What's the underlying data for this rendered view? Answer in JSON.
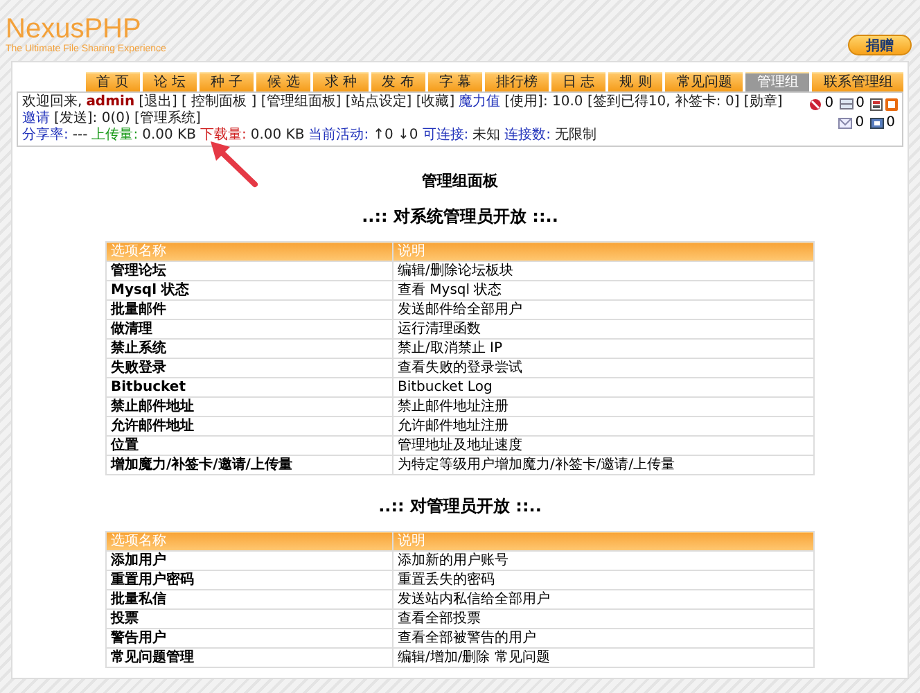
{
  "logo": {
    "title": "NexusPHP",
    "tagline": "The Ultimate File Sharing Experience"
  },
  "donate_button": "捐赠",
  "nav": [
    {
      "label": "首 页",
      "selected": false
    },
    {
      "label": "论 坛",
      "selected": false
    },
    {
      "label": "种 子",
      "selected": false
    },
    {
      "label": "候 选",
      "selected": false
    },
    {
      "label": "求 种",
      "selected": false
    },
    {
      "label": "发 布",
      "selected": false
    },
    {
      "label": "字 幕",
      "selected": false
    },
    {
      "label": "排行榜",
      "selected": false
    },
    {
      "label": "日 志",
      "selected": false
    },
    {
      "label": "规 则",
      "selected": false
    },
    {
      "label": "常见问题",
      "selected": false
    },
    {
      "label": "管理组",
      "selected": true
    },
    {
      "label": "联系管理组",
      "selected": false
    }
  ],
  "user_bar": {
    "lines": [
      [
        {
          "kind": "text",
          "text": "欢迎回来,"
        },
        {
          "kind": "user",
          "text": "admin"
        },
        {
          "kind": "text",
          "text": "[退出] [ 控制面板 ] [管理组面板] [站点设定] [收藏]"
        },
        {
          "kind": "link",
          "text": "魔力值"
        },
        {
          "kind": "text",
          "text": "[使用]: 10.0 [签到已得10, 补签卡: 0] [勋章]"
        },
        {
          "kind": "link",
          "text": "邀请"
        },
        {
          "kind": "text",
          "text": "[发送]: 0(0) [管理系统]"
        }
      ],
      [
        {
          "kind": "link",
          "text": "分享率:"
        },
        {
          "kind": "text",
          "text": "---"
        },
        {
          "kind": "up",
          "text": "上传量:"
        },
        {
          "kind": "text",
          "text": "0.00 KB"
        },
        {
          "kind": "down",
          "text": "下载量:"
        },
        {
          "kind": "text",
          "text": "0.00 KB"
        },
        {
          "kind": "link",
          "text": "当前活动:"
        },
        {
          "kind": "text",
          "text": "↑0 ↓0"
        },
        {
          "kind": "link",
          "text": "可连接:"
        },
        {
          "kind": "text",
          "text": "未知"
        },
        {
          "kind": "link",
          "text": "连接数:"
        },
        {
          "kind": "text",
          "text": "无限制"
        }
      ]
    ],
    "indicators": [
      [
        {
          "kind": "alert",
          "count": "0"
        },
        {
          "kind": "inbox",
          "count": "0"
        },
        {
          "kind": "bookmark"
        },
        {
          "kind": "rss"
        }
      ],
      [
        {
          "kind": "mail",
          "count": "0"
        },
        {
          "kind": "sent",
          "count": "0"
        }
      ]
    ]
  },
  "panel_title": "管理组面板",
  "sections": [
    {
      "heading": "..:: 对系统管理员开放 ::..",
      "columns": [
        "选项名称",
        "说明"
      ],
      "rows": [
        [
          "管理论坛",
          "编辑/删除论坛板块"
        ],
        [
          "Mysql 状态",
          "查看 Mysql 状态"
        ],
        [
          "批量邮件",
          "发送邮件给全部用户"
        ],
        [
          "做清理",
          "运行清理函数"
        ],
        [
          "禁止系统",
          "禁止/取消禁止 IP"
        ],
        [
          "失败登录",
          "查看失败的登录尝试"
        ],
        [
          "Bitbucket",
          "Bitbucket Log"
        ],
        [
          "禁止邮件地址",
          "禁止邮件地址注册"
        ],
        [
          "允许邮件地址",
          "允许邮件地址注册"
        ],
        [
          "位置",
          "管理地址及地址速度"
        ],
        [
          "增加魔力/补签卡/邀请/上传量",
          "为特定等级用户增加魔力/补签卡/邀请/上传量"
        ]
      ]
    },
    {
      "heading": "..:: 对管理员开放 ::..",
      "columns": [
        "选项名称",
        "说明"
      ],
      "rows": [
        [
          "添加用户",
          "添加新的用户账号"
        ],
        [
          "重置用户密码",
          "重置丢失的密码"
        ],
        [
          "批量私信",
          "发送站内私信给全部用户"
        ],
        [
          "投票",
          "查看全部投票"
        ],
        [
          "警告用户",
          "查看全部被警告的用户"
        ],
        [
          "常见问题管理",
          "编辑/增加/删除 常见问题"
        ]
      ]
    }
  ]
}
